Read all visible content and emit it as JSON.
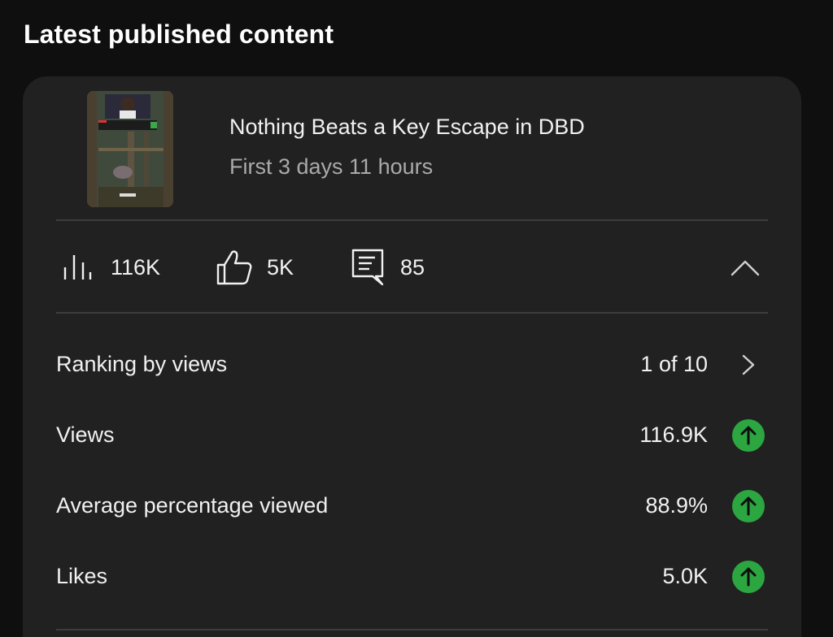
{
  "section": {
    "title": "Latest published content"
  },
  "video": {
    "title": "Nothing Beats a Key Escape in DBD",
    "subtitle": "First 3 days 11 hours",
    "thumbnail_icon": "video-thumbnail"
  },
  "quick_stats": {
    "views": {
      "icon": "views-bar-icon",
      "value": "116K"
    },
    "likes": {
      "icon": "thumbs-up-icon",
      "value": "5K"
    },
    "comments": {
      "icon": "comment-icon",
      "value": "85"
    },
    "toggle_icon": "chevron-up-icon"
  },
  "metrics": [
    {
      "label": "Ranking by views",
      "value": "1 of 10",
      "icon": "chevron-right-icon"
    },
    {
      "label": "Views",
      "value": "116.9K",
      "icon": "trend-up-icon"
    },
    {
      "label": "Average percentage viewed",
      "value": "88.9%",
      "icon": "trend-up-icon"
    },
    {
      "label": "Likes",
      "value": "5.0K",
      "icon": "trend-up-icon"
    }
  ],
  "colors": {
    "background": "#0f0f0f",
    "card": "#212121",
    "divider": "#3d3d3d",
    "trend_up": "#2ba640",
    "muted_text": "#aaaaaa"
  }
}
